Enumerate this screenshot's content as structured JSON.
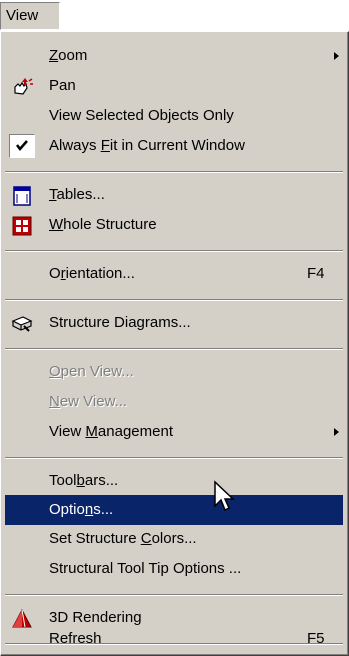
{
  "menubar": {
    "title": "View"
  },
  "menu": {
    "items": [
      {
        "pre": "",
        "u": "Z",
        "post": "oom",
        "submenu": true
      },
      {
        "pre": "Pan",
        "u": "",
        "post": ""
      },
      {
        "pre": "View Selected Objects Only",
        "u": "",
        "post": ""
      },
      {
        "pre": "Always ",
        "u": "F",
        "post": "it in Current Window",
        "checked": true
      },
      {
        "pre": "",
        "u": "T",
        "post": "ables..."
      },
      {
        "pre": "",
        "u": "W",
        "post": "hole Structure"
      },
      {
        "pre": "O",
        "u": "r",
        "post": "ientation...",
        "shortcut": "F4"
      },
      {
        "pre": "Structure Diagrams...",
        "u": "",
        "post": ""
      },
      {
        "pre": "",
        "u": "O",
        "post": "pen View...",
        "disabled": true
      },
      {
        "pre": "",
        "u": "N",
        "post": "ew View...",
        "disabled": true
      },
      {
        "pre": "View ",
        "u": "M",
        "post": "anagement",
        "submenu": true
      },
      {
        "pre": "Tool",
        "u": "b",
        "post": "ars..."
      },
      {
        "pre": "Optio",
        "u": "n",
        "post": "s...",
        "selected": true
      },
      {
        "pre": "Set Structure ",
        "u": "C",
        "post": "olors..."
      },
      {
        "pre": "Structural Tool Tip Options ...",
        "u": "",
        "post": ""
      },
      {
        "pre": "3D Rendering",
        "u": "",
        "post": ""
      },
      {
        "pre": "Refresh",
        "u": "",
        "post": "",
        "shortcut": "F5"
      }
    ]
  },
  "icons": {
    "pan": "pan-hand-icon",
    "check": "check-icon",
    "tables": "table-window-icon",
    "whole_structure": "whole-structure-icon",
    "structure_diagrams": "structure-diagrams-icon",
    "rendering": "3d-rendering-icon",
    "cursor": "mouse-pointer-icon"
  },
  "colors": {
    "menu_bg": "#d4d0c8",
    "highlight": "#0a246a",
    "disabled_text": "#808080"
  }
}
